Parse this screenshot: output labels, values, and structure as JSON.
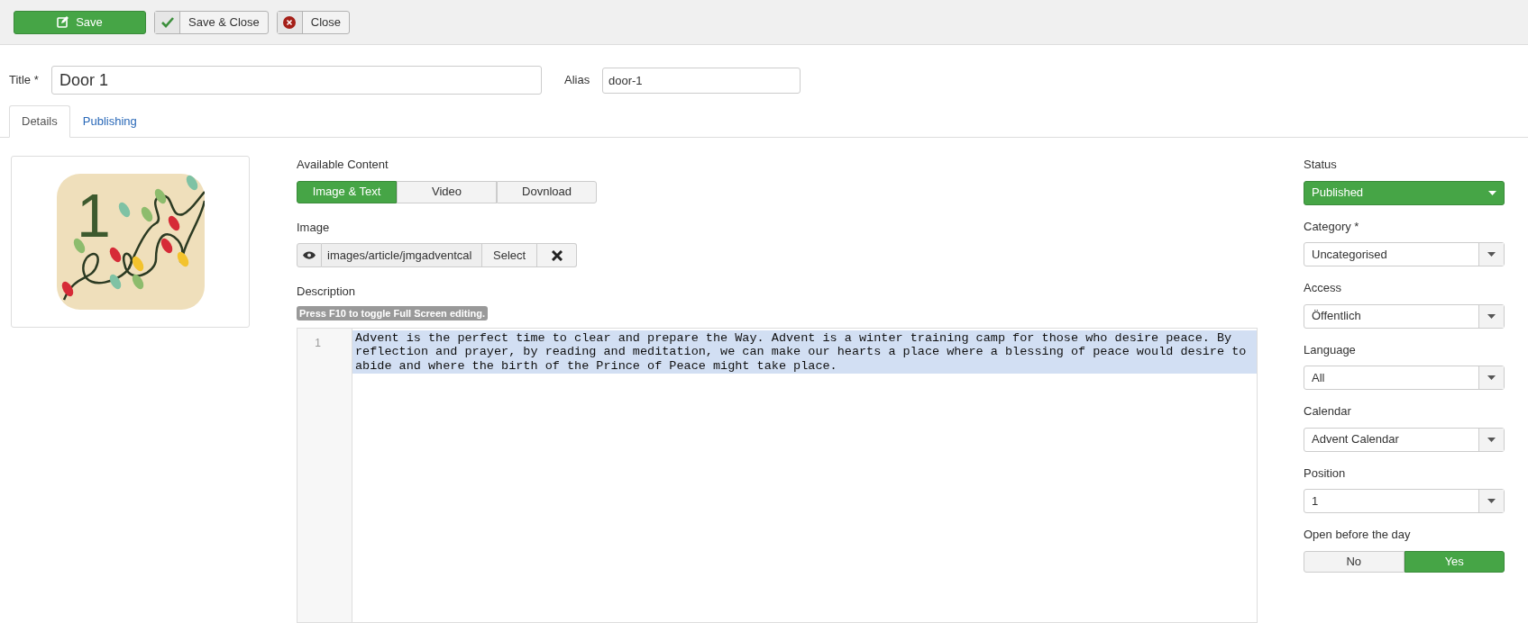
{
  "toolbar": [
    {
      "label": "Save",
      "kind": "primary"
    },
    {
      "label": "Save & Close",
      "kind": "check"
    },
    {
      "label": "Close",
      "kind": "close"
    }
  ],
  "title": {
    "label": "Title *",
    "value": "Door 1"
  },
  "alias": {
    "label": "Alias",
    "value": "door-1"
  },
  "tabs": [
    {
      "label": "Details",
      "selected": true
    },
    {
      "label": "Publishing",
      "selected": false
    }
  ],
  "preview": {
    "number": "1"
  },
  "content": {
    "label": "Available Content",
    "options": [
      {
        "label": "Image & Text",
        "selected": true
      },
      {
        "label": "Video",
        "selected": false
      },
      {
        "label": "Dovnload",
        "selected": false
      }
    ]
  },
  "image": {
    "label": "Image",
    "value": "images/article/jmgadventcal",
    "select": "Select"
  },
  "description": {
    "label": "Description",
    "hint": "Press F10 to toggle Full Screen editing.",
    "line_number": "1",
    "text": "Advent is the perfect time to clear and prepare the Way. Advent is a winter training camp for those who desire peace. By reflection and prayer, by reading and meditation, we can make our hearts a place where a blessing of peace would desire to abide and where the birth of the Prince of Peace might take place."
  },
  "sidebar": [
    {
      "label": "Status",
      "value": "Published",
      "kind": "status"
    },
    {
      "label": "Category *",
      "value": "Uncategorised",
      "kind": "select"
    },
    {
      "label": "Access",
      "value": "Öffentlich",
      "kind": "select"
    },
    {
      "label": "Language",
      "value": "All",
      "kind": "select"
    },
    {
      "label": "Calendar",
      "value": "Advent Calendar",
      "kind": "select"
    },
    {
      "label": "Position",
      "value": "1",
      "kind": "select"
    },
    {
      "label": "Open before the day",
      "kind": "toggle",
      "options": [
        {
          "label": "No",
          "selected": false
        },
        {
          "label": "Yes",
          "selected": true
        }
      ]
    }
  ]
}
